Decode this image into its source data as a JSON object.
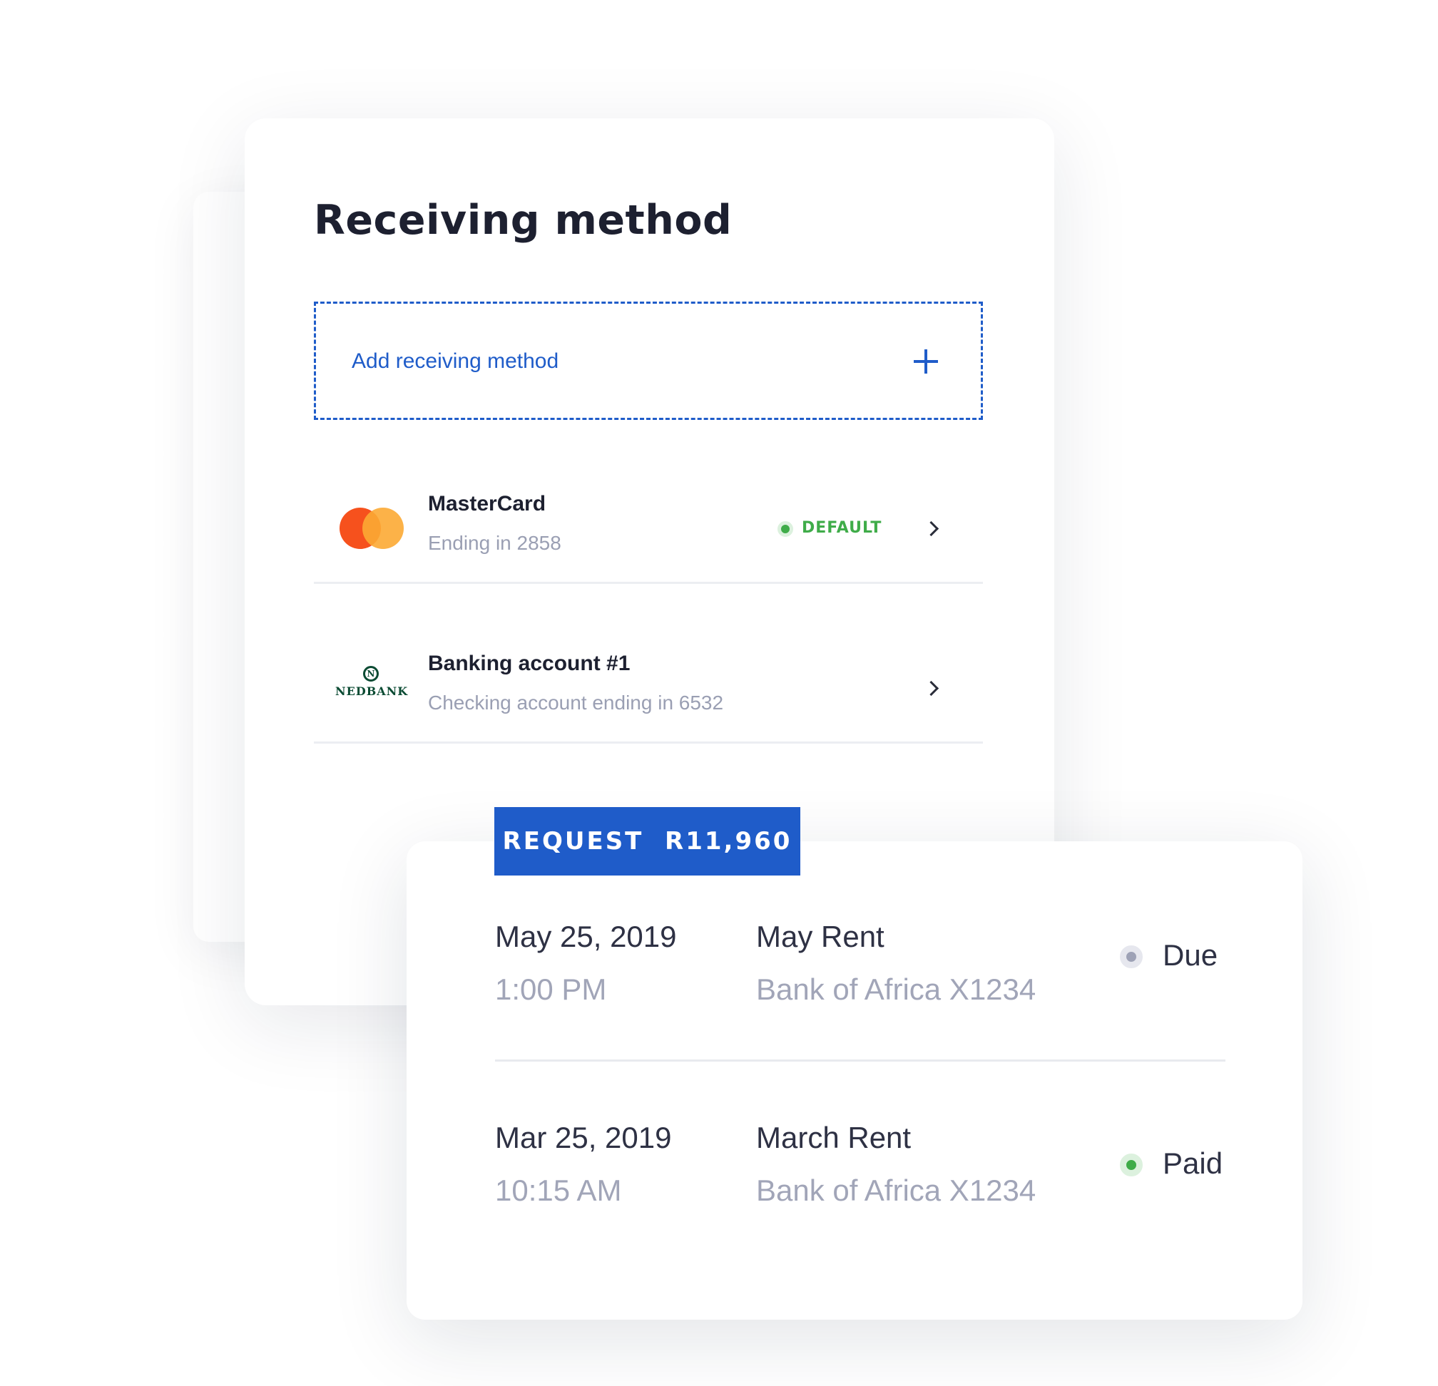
{
  "receiving": {
    "title": "Receiving method",
    "add_label": "Add receiving method",
    "methods": [
      {
        "logo": "mastercard-logo",
        "name": "MasterCard",
        "detail": "Ending in 2858",
        "badge": "DEFAULT"
      },
      {
        "logo": "nedbank-logo",
        "logo_text": "NEDBANK",
        "name": "Banking account #1",
        "detail": "Checking account ending in 6532"
      }
    ]
  },
  "request_button": {
    "label": "REQUEST  R11,960",
    "color": "#1f5cc9"
  },
  "transactions": [
    {
      "date": "May 25, 2019",
      "time": "1:00 PM",
      "description": "May Rent",
      "account": "Bank of Africa X1234",
      "status": "Due",
      "status_color": "#9ea2b6"
    },
    {
      "date": "Mar 25, 2019",
      "time": "10:15 AM",
      "description": "March Rent",
      "account": "Bank of Africa X1234",
      "status": "Paid",
      "status_color": "#3fac49"
    }
  ],
  "colors": {
    "accent": "#1f5cc9",
    "success": "#3fac49",
    "text_primary": "#1d2030",
    "text_muted": "#9a9fb3"
  },
  "icons": [
    "plus-icon",
    "chevron-right-icon",
    "status-dot-icon"
  ]
}
